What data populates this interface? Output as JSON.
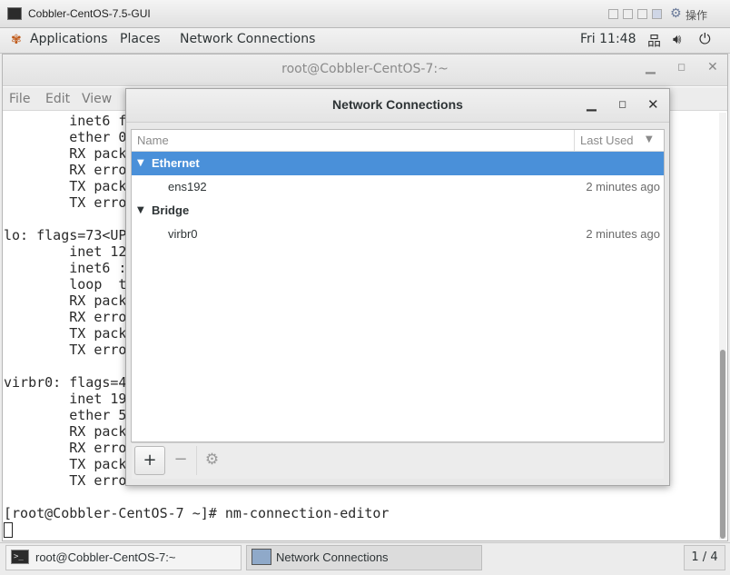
{
  "vm": {
    "title": "Cobbler-CentOS-7.5-GUI",
    "operate_label": "操作"
  },
  "topbar": {
    "applications": "Applications",
    "places": "Places",
    "active_app": "Network Connections",
    "clock": "Fri 11:48",
    "icons": [
      "applications-icon",
      "network-icon",
      "volume-icon",
      "power-icon"
    ]
  },
  "terminal": {
    "title": "root@Cobbler-CentOS-7:~",
    "menu": [
      "File",
      "Edit",
      "View"
    ],
    "lines": [
      "        inet6 f",
      "        ether 0",
      "        RX pack",
      "        RX erro",
      "        TX pack",
      "        TX erro",
      "",
      "lo: flags=73<UP",
      "        inet 12",
      "        inet6 :",
      "        loop  t",
      "        RX pack",
      "        RX erro",
      "        TX pack",
      "        TX erro",
      "",
      "virbr0: flags=4",
      "        inet 19",
      "        ether 5",
      "        RX pack",
      "        RX erro",
      "        TX pack",
      "        TX erro",
      "",
      "[root@Cobbler-CentOS-7 ~]# nm-connection-editor"
    ]
  },
  "dialog": {
    "title": "Network Connections",
    "columns": {
      "name": "Name",
      "last_used": "Last Used"
    },
    "groups": [
      {
        "label": "Ethernet",
        "selected": true,
        "connections": [
          {
            "name": "ens192",
            "last_used": "2 minutes ago"
          }
        ]
      },
      {
        "label": "Bridge",
        "selected": false,
        "connections": [
          {
            "name": "virbr0",
            "last_used": "2 minutes ago"
          }
        ]
      }
    ],
    "toolbar": {
      "add": "+",
      "remove": "−",
      "settings": "⚙"
    }
  },
  "taskbar": {
    "items": [
      {
        "label": "root@Cobbler-CentOS-7:~",
        "active": false
      },
      {
        "label": "Network Connections",
        "active": true
      }
    ],
    "workspace": "1 / 4"
  },
  "colors": {
    "selection": "#4a90d9",
    "terminal_bg": "#ffffff",
    "terminal_fg": "#2a2a2a"
  }
}
